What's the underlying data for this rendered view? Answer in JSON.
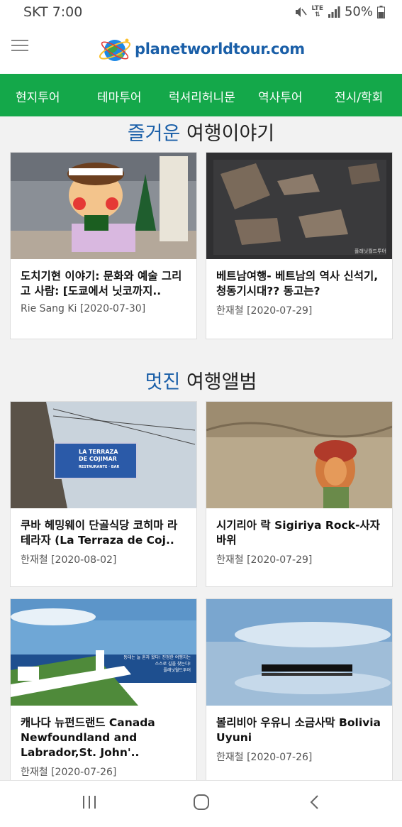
{
  "status_bar": {
    "carrier": "SKT 7:00",
    "battery": "50%",
    "signal_label": "LTE"
  },
  "header": {
    "logo_text": "planetworldtour.com"
  },
  "nav": {
    "items": [
      "현지투어",
      "테마투어",
      "럭셔리허니문",
      "역사투어",
      "전시/학회"
    ]
  },
  "stories": {
    "title_accent": "즐거운",
    "title_rest": " 여행이야기",
    "cards": [
      {
        "title": "도치기현 이야기: 문화와 예술 그리고 사람: [도쿄에서 닛코까지..",
        "author": "Rie Sang Ki",
        "date": "[2020-07-30]"
      },
      {
        "title": "베트남여행- 베트남의 역사 신석기, 청동기시대?? 동고는?",
        "author": "한재철",
        "date": "[2020-07-29]",
        "image_caption": "플래닛월드투어"
      }
    ]
  },
  "album": {
    "title_accent": "멋진",
    "title_rest": " 여행앨범",
    "cards": [
      {
        "title": "쿠바 헤밍웨이 단골식당 코히마 라 테라자 (La Terraza de Coj..",
        "author": "한재철",
        "date": "[2020-08-02]",
        "sign_line1": "LA TERRAZA",
        "sign_line2": "DE COJIMAR",
        "sign_line3": "RESTAURANTE · BAR"
      },
      {
        "title": "시기리아 락 Sigiriya Rock-사자 바위",
        "author": "한재철",
        "date": "[2020-07-29]"
      },
      {
        "title": "캐나다 뉴펀드랜드 Canada Newfoundland and Labrador,St. John'..",
        "author": "한재철",
        "date": "[2020-07-26]",
        "image_caption1": "동대는 늘 혼자 왔다! 진정한 여행자는",
        "image_caption2": "스스로 길을 찾는다!",
        "image_caption3": "플래닛월드투어"
      },
      {
        "title": "볼리비아 우유니 소금사막 Bolivia Uyuni",
        "author": "한재철",
        "date": "[2020-07-26]"
      }
    ]
  },
  "colors": {
    "brand_green": "#14a84a",
    "brand_blue": "#1a5fa8"
  }
}
